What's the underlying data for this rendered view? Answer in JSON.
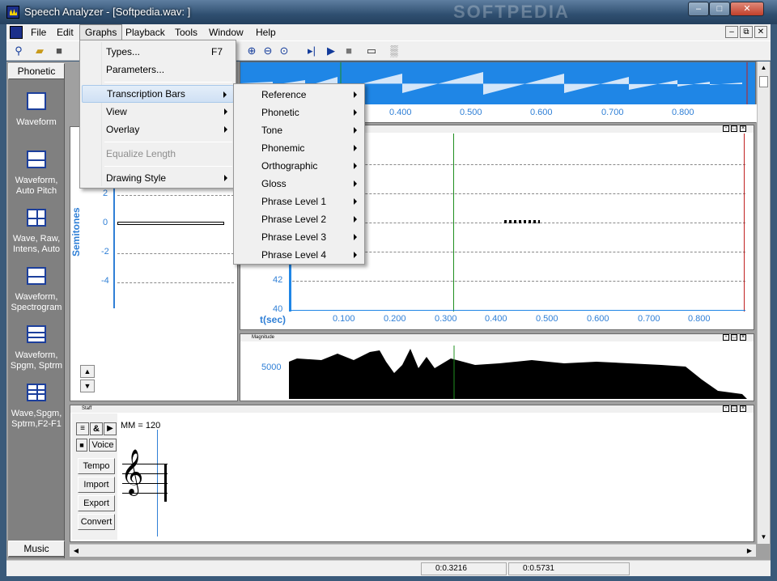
{
  "window": {
    "title": "Speech Analyzer - [Softpedia.wav: ]",
    "min": "–",
    "max": "□",
    "close": "✕",
    "watermark": "SOFTPEDIA"
  },
  "menubar": {
    "items": [
      "File",
      "Edit",
      "Graphs",
      "Playback",
      "Tools",
      "Window",
      "Help"
    ],
    "open_index": 2,
    "mdi_min": "–",
    "mdi_restore": "⧉",
    "mdi_close": "✕"
  },
  "toolbar": {
    "icons": [
      "wand-icon",
      "open-folder-icon",
      "save-icon",
      "zoom-in-icon",
      "zoom-out-icon",
      "zoom-all-icon",
      "play-to-icon",
      "play-icon",
      "stop-icon",
      "record-icon",
      "waveform-icon"
    ]
  },
  "sidebar": {
    "top_tab": "Phonetic",
    "bottom_tab": "Music",
    "items": [
      {
        "label": "Waveform",
        "icon": "waveform-layout-icon"
      },
      {
        "label": "Waveform, Auto Pitch",
        "icon": "two-pane-layout-icon"
      },
      {
        "label": "Wave, Raw, Intens, Auto",
        "icon": "four-pane-layout-icon"
      },
      {
        "label": "Waveform, Spectrogram",
        "icon": "two-pane-layout-icon"
      },
      {
        "label": "Waveform, Spgm, Sptrm",
        "icon": "three-pane-layout-icon"
      },
      {
        "label": "Wave,Spgm, Sptrm,F2-F1",
        "icon": "four-row-layout-icon"
      }
    ]
  },
  "graphs_menu": {
    "items": [
      {
        "label": "Types...",
        "shortcut": "F7",
        "type": "item"
      },
      {
        "label": "Parameters...",
        "shortcut": "",
        "type": "item"
      },
      {
        "type": "separator"
      },
      {
        "label": "Transcription Bars",
        "submenu": true,
        "type": "item",
        "selected": true
      },
      {
        "label": "View",
        "submenu": true,
        "type": "item"
      },
      {
        "label": "Overlay",
        "submenu": true,
        "type": "item"
      },
      {
        "type": "separator"
      },
      {
        "label": "Equalize Length",
        "type": "item",
        "disabled": true
      },
      {
        "type": "separator"
      },
      {
        "label": "Drawing Style",
        "submenu": true,
        "type": "item"
      }
    ]
  },
  "transcription_submenu": {
    "items": [
      "Reference",
      "Phonetic",
      "Tone",
      "Phonemic",
      "Orthographic",
      "Gloss",
      "Phrase Level 1",
      "Phrase Level 2",
      "Phrase Level 3",
      "Phrase Level 4"
    ]
  },
  "waveform_panel": {
    "time_ticks": [
      "0.400",
      "0.500",
      "0.600",
      "0.700",
      "0.800"
    ]
  },
  "pitch_panel": {
    "y_axis_label": "Semitones",
    "semitone_ticks": [
      "2",
      "0",
      "-2",
      "-4"
    ],
    "y_ticks_right": [
      "42",
      "40"
    ],
    "x_axis_label": "t(sec)",
    "time_ticks": [
      "0.100",
      "0.200",
      "0.300",
      "0.400",
      "0.500",
      "0.600",
      "0.700",
      "0.800"
    ]
  },
  "spectrum_panel": {
    "title": "Magnitude",
    "y_tick": "5000"
  },
  "staff_panel": {
    "title": "Staff",
    "tempo_text": "MM = 120",
    "buttons": [
      "Tempo",
      "Import",
      "Export",
      "Convert"
    ],
    "voice_label": "Voice",
    "and_label": "&"
  },
  "statusbar": {
    "cursor1": "0:0.3216",
    "cursor2": "0:0.5731"
  },
  "colors": {
    "accent_blue": "#1f86e6",
    "axis_blue": "#2f7fd6",
    "cursor_green": "#1f8f1f",
    "cursor_red": "#c02020"
  }
}
